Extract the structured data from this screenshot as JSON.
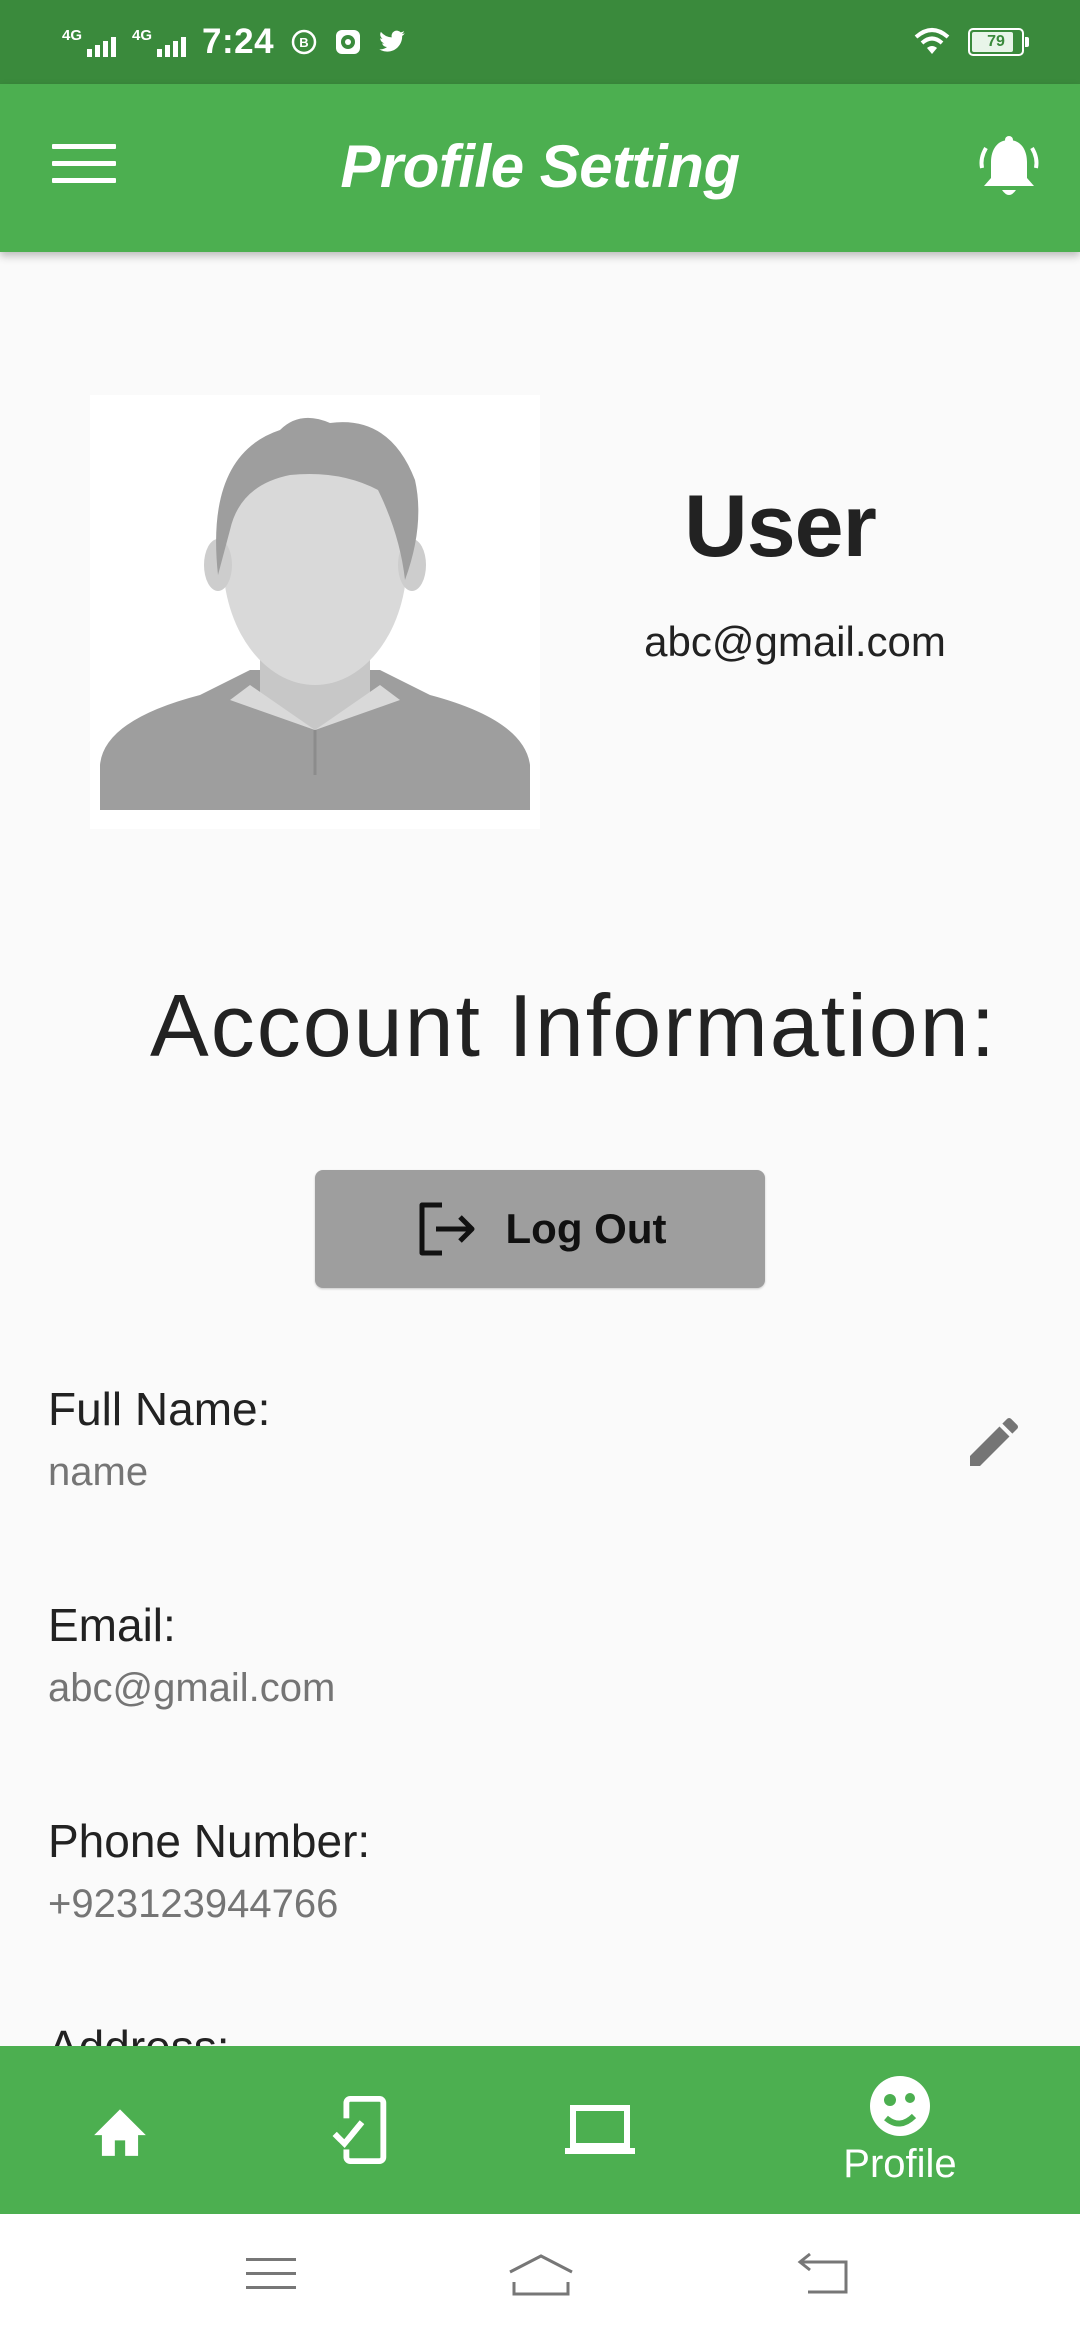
{
  "status_bar": {
    "time": "7:24",
    "network_1": "4G",
    "network_2": "4G",
    "battery_level": "79"
  },
  "app_bar": {
    "title": "Profile Setting",
    "background": "#4caf50",
    "menu_icon": "hamburger-menu-icon",
    "notification_icon": "bell-icon"
  },
  "profile": {
    "name": "User",
    "email": "abc@gmail.com",
    "avatar_icon": "default-avatar"
  },
  "account": {
    "section_title": "Account Information:",
    "logout_label": "Log Out",
    "fields": [
      {
        "label": "Full Name:",
        "value": "name"
      },
      {
        "label": "Email:",
        "value": "abc@gmail.com"
      },
      {
        "label": "Phone Number:",
        "value": "+923123944766"
      },
      {
        "label": "Address:"
      }
    ]
  },
  "bottom_nav": {
    "items": [
      {
        "icon": "home-icon",
        "label": ""
      },
      {
        "icon": "phone-check-icon",
        "label": ""
      },
      {
        "icon": "laptop-icon",
        "label": ""
      },
      {
        "icon": "profile-face-icon",
        "label": "Profile"
      }
    ]
  }
}
